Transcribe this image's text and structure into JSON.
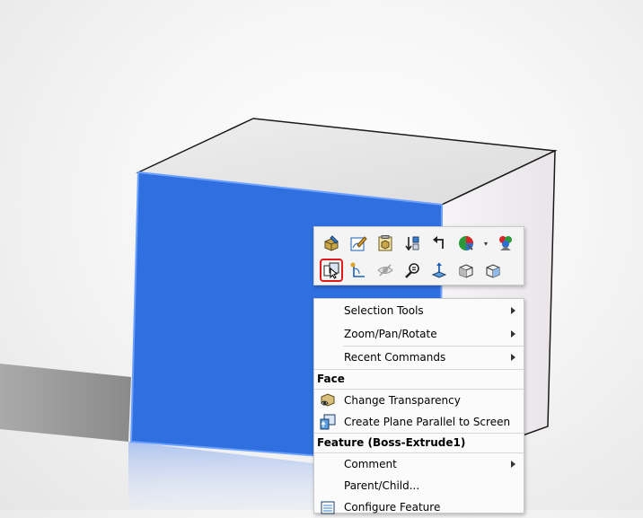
{
  "colors": {
    "face_selected": "#2f6fe0",
    "highlight_border": "#e01b1b",
    "menu_bg": "#fbfbfb"
  },
  "toolbar": {
    "row1": [
      {
        "name": "edit-feature-icon"
      },
      {
        "name": "edit-sketch-icon"
      },
      {
        "name": "edit-part-icon"
      },
      {
        "name": "rollback-icon"
      },
      {
        "name": "undo-arrow-icon"
      },
      {
        "name": "appearance-icon"
      },
      {
        "name": "appearance-dropdown-icon"
      },
      {
        "name": "display-style-icon"
      }
    ],
    "row2": [
      {
        "name": "normal-to-view-icon",
        "highlighted": true
      },
      {
        "name": "sketch-icon"
      },
      {
        "name": "hide-icon"
      },
      {
        "name": "zoom-to-selection-icon"
      },
      {
        "name": "measure-icon"
      },
      {
        "name": "view-orientation-icon"
      },
      {
        "name": "isometric-view-icon"
      }
    ]
  },
  "menu": {
    "selection_tools": "Selection Tools",
    "zoom_pan_rotate": "Zoom/Pan/Rotate",
    "recent_commands": "Recent Commands",
    "section_face": "Face",
    "change_transparency": "Change Transparency",
    "create_plane": "Create Plane Parallel to Screen",
    "section_feature": "Feature (Boss-Extrude1)",
    "comment": "Comment",
    "parent_child": "Parent/Child...",
    "configure_feature": "Configure Feature"
  }
}
